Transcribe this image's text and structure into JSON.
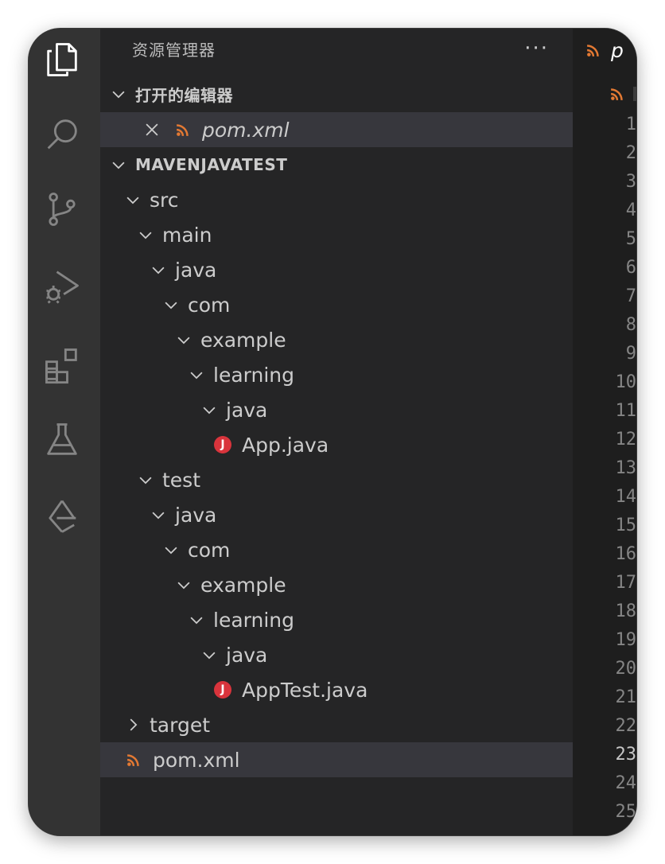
{
  "activity_bar": {
    "icons": [
      "files-icon",
      "search-icon",
      "source-control-icon",
      "run-debug-icon",
      "extensions-icon",
      "testing-icon",
      "remote-explorer-icon"
    ]
  },
  "sidebar": {
    "title": "资源管理器",
    "more": "···",
    "open_editors": {
      "label": "打开的编辑器",
      "items": [
        {
          "name": "pom.xml"
        }
      ]
    },
    "workspace": {
      "label": "MAVENJAVATEST",
      "tree": [
        {
          "name": "src",
          "depth": 1,
          "kind": "folder",
          "expanded": true
        },
        {
          "name": "main",
          "depth": 2,
          "kind": "folder",
          "expanded": true
        },
        {
          "name": "java",
          "depth": 3,
          "kind": "folder",
          "expanded": true
        },
        {
          "name": "com",
          "depth": 4,
          "kind": "folder",
          "expanded": true
        },
        {
          "name": "example",
          "depth": 5,
          "kind": "folder",
          "expanded": true
        },
        {
          "name": "learning",
          "depth": 6,
          "kind": "folder",
          "expanded": true
        },
        {
          "name": "java",
          "depth": 7,
          "kind": "folder",
          "expanded": true
        },
        {
          "name": "App.java",
          "depth": 8,
          "kind": "java"
        },
        {
          "name": "test",
          "depth": 2,
          "kind": "folder",
          "expanded": true
        },
        {
          "name": "java",
          "depth": 3,
          "kind": "folder",
          "expanded": true
        },
        {
          "name": "com",
          "depth": 4,
          "kind": "folder",
          "expanded": true
        },
        {
          "name": "example",
          "depth": 5,
          "kind": "folder",
          "expanded": true
        },
        {
          "name": "learning",
          "depth": 6,
          "kind": "folder",
          "expanded": true
        },
        {
          "name": "java",
          "depth": 7,
          "kind": "folder",
          "expanded": true
        },
        {
          "name": "AppTest.java",
          "depth": 8,
          "kind": "java"
        },
        {
          "name": "target",
          "depth": 1,
          "kind": "folder",
          "expanded": false
        },
        {
          "name": "pom.xml",
          "depth": 1,
          "kind": "xml",
          "selected": true
        }
      ]
    }
  },
  "editor": {
    "tab_label": "p",
    "line_numbers": [
      "1",
      "2",
      "3",
      "4",
      "5",
      "6",
      "7",
      "8",
      "9",
      "10",
      "11",
      "12",
      "13",
      "14",
      "15",
      "16",
      "17",
      "18",
      "19",
      "20",
      "21",
      "22",
      "23",
      "24",
      "25"
    ],
    "current_line": "23"
  },
  "colors": {
    "java_icon": "#d9343c",
    "xml_icon": "#e37933",
    "selection": "#37373d"
  }
}
